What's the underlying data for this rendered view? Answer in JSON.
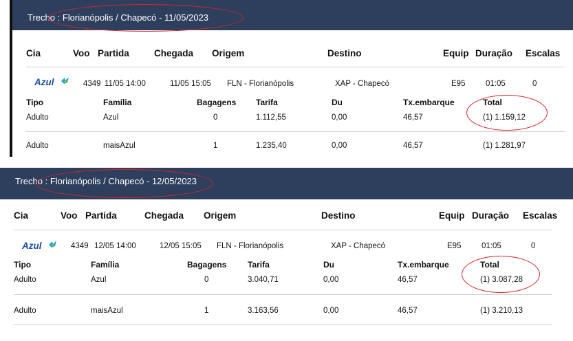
{
  "columns": [
    "Cia",
    "Voo",
    "Partida",
    "Chegada",
    "Origem",
    "Destino",
    "Equip",
    "Duração",
    "Escalas"
  ],
  "fare_columns": [
    "Tipo",
    "Família",
    "Bagagens",
    "Tarifa",
    "Du",
    "Tx.embarque",
    "Total"
  ],
  "sections": [
    {
      "header": "Trecho : Florianópolis / Chapecó - 11/05/2023",
      "flight": {
        "airline": "Azul",
        "voo": "4349",
        "partida": "11/05 14:00",
        "chegada": "11/05 15:05",
        "origem": "FLN - Florianópolis",
        "destino": "XAP - Chapecó",
        "equip": "E95",
        "duracao": "01:05",
        "escalas": "0"
      },
      "fares": [
        {
          "tipo": "Adulto",
          "familia": "Azul",
          "bagagens": "0",
          "tarifa": "1.112,55",
          "du": "0,00",
          "tx": "46,57",
          "total": "(1) 1.159,12"
        },
        {
          "tipo": "Adulto",
          "familia": "maisAzul",
          "bagagens": "1",
          "tarifa": "1.235,40",
          "du": "0,00",
          "tx": "46,57",
          "total": "(1) 1.281,97"
        }
      ]
    },
    {
      "header": "Trecho : Florianópolis / Chapecó - 12/05/2023",
      "flight": {
        "airline": "Azul",
        "voo": "4349",
        "partida": "12/05 14:00",
        "chegada": "12/05 15:05",
        "origem": "FLN - Florianópolis",
        "destino": "XAP - Chapecó",
        "equip": "E95",
        "duracao": "01:05",
        "escalas": "0"
      },
      "fares": [
        {
          "tipo": "Adulto",
          "familia": "Azul",
          "bagagens": "0",
          "tarifa": "3.040,71",
          "du": "0,00",
          "tx": "46,57",
          "total": "(1) 3.087,28"
        },
        {
          "tipo": "Adulto",
          "familia": "maisAzul",
          "bagagens": "1",
          "tarifa": "3.163,56",
          "du": "0,00",
          "tx": "46,57",
          "total": "(1) 3.210,13"
        }
      ]
    }
  ],
  "colors": {
    "header_bg": "#2e3f5e",
    "annotation": "#d0262a",
    "airline_logo": "#1b4f9c"
  },
  "icons": {
    "airline_logo": "azul-bird-icon"
  }
}
